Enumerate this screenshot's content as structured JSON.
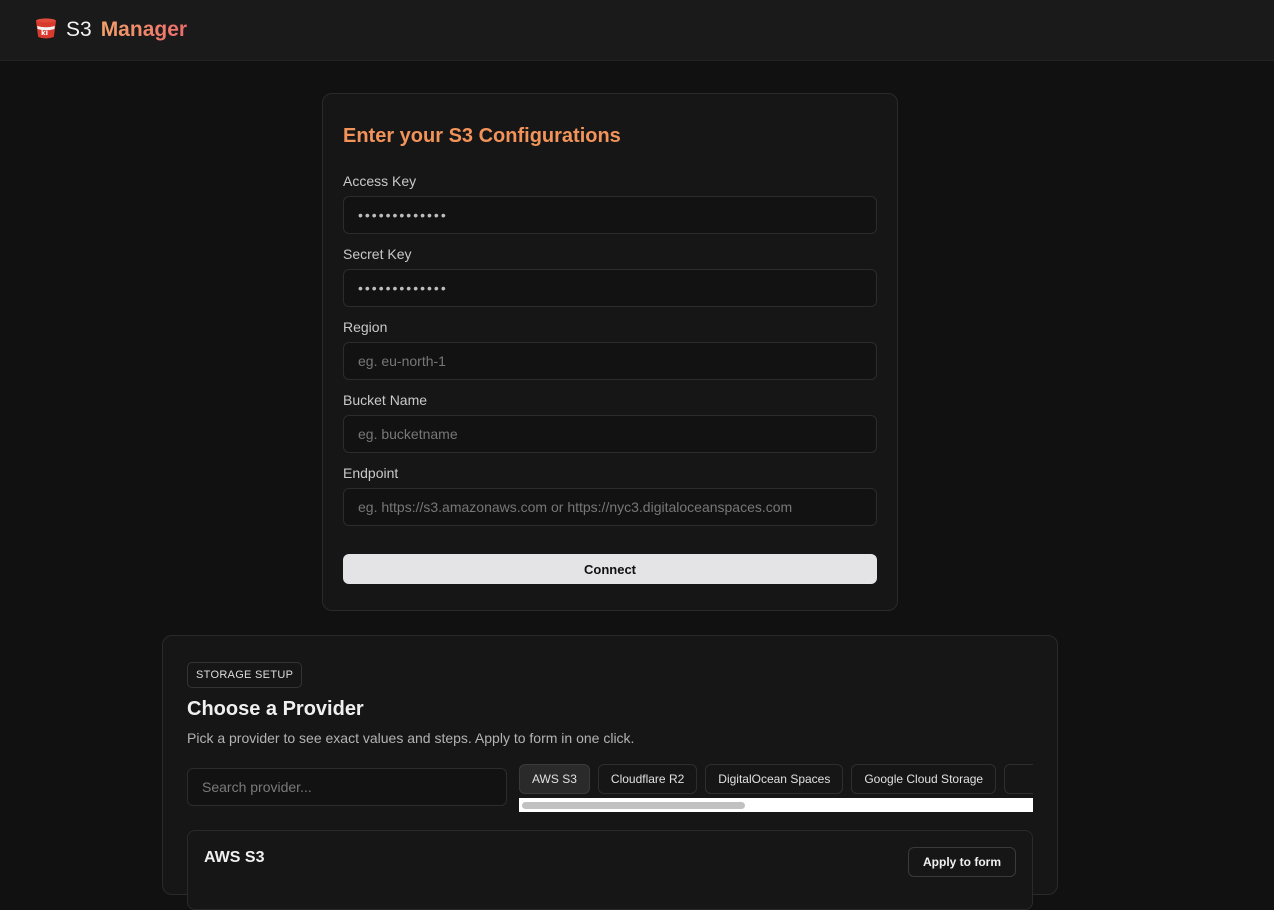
{
  "header": {
    "brand_part1": "S3",
    "brand_part2": "Manager",
    "logo_icon": "bucket-icon"
  },
  "config_form": {
    "title": "Enter your S3 Configurations",
    "fields": {
      "access_key": {
        "label": "Access Key",
        "value": "•••••••••••••",
        "placeholder": ""
      },
      "secret_key": {
        "label": "Secret Key",
        "value": "•••••••••••••",
        "placeholder": ""
      },
      "region": {
        "label": "Region",
        "value": "",
        "placeholder": "eg. eu-north-1"
      },
      "bucket": {
        "label": "Bucket Name",
        "value": "",
        "placeholder": "eg. bucketname"
      },
      "endpoint": {
        "label": "Endpoint",
        "value": "",
        "placeholder": "eg. https://s3.amazonaws.com or https://nyc3.digitaloceanspaces.com"
      }
    },
    "connect_label": "Connect"
  },
  "provider_section": {
    "badge": "STORAGE SETUP",
    "title": "Choose a Provider",
    "subtitle": "Pick a provider to see exact values and steps. Apply to form in one click.",
    "search_placeholder": "Search provider...",
    "providers": [
      "AWS S3",
      "Cloudflare R2",
      "DigitalOcean Spaces",
      "Google Cloud Storage"
    ],
    "selected": "AWS S3",
    "detail_title": "AWS S3",
    "apply_label": "Apply to form"
  },
  "colors": {
    "accent": "#f2935a",
    "background": "#111111",
    "card": "#161616"
  }
}
